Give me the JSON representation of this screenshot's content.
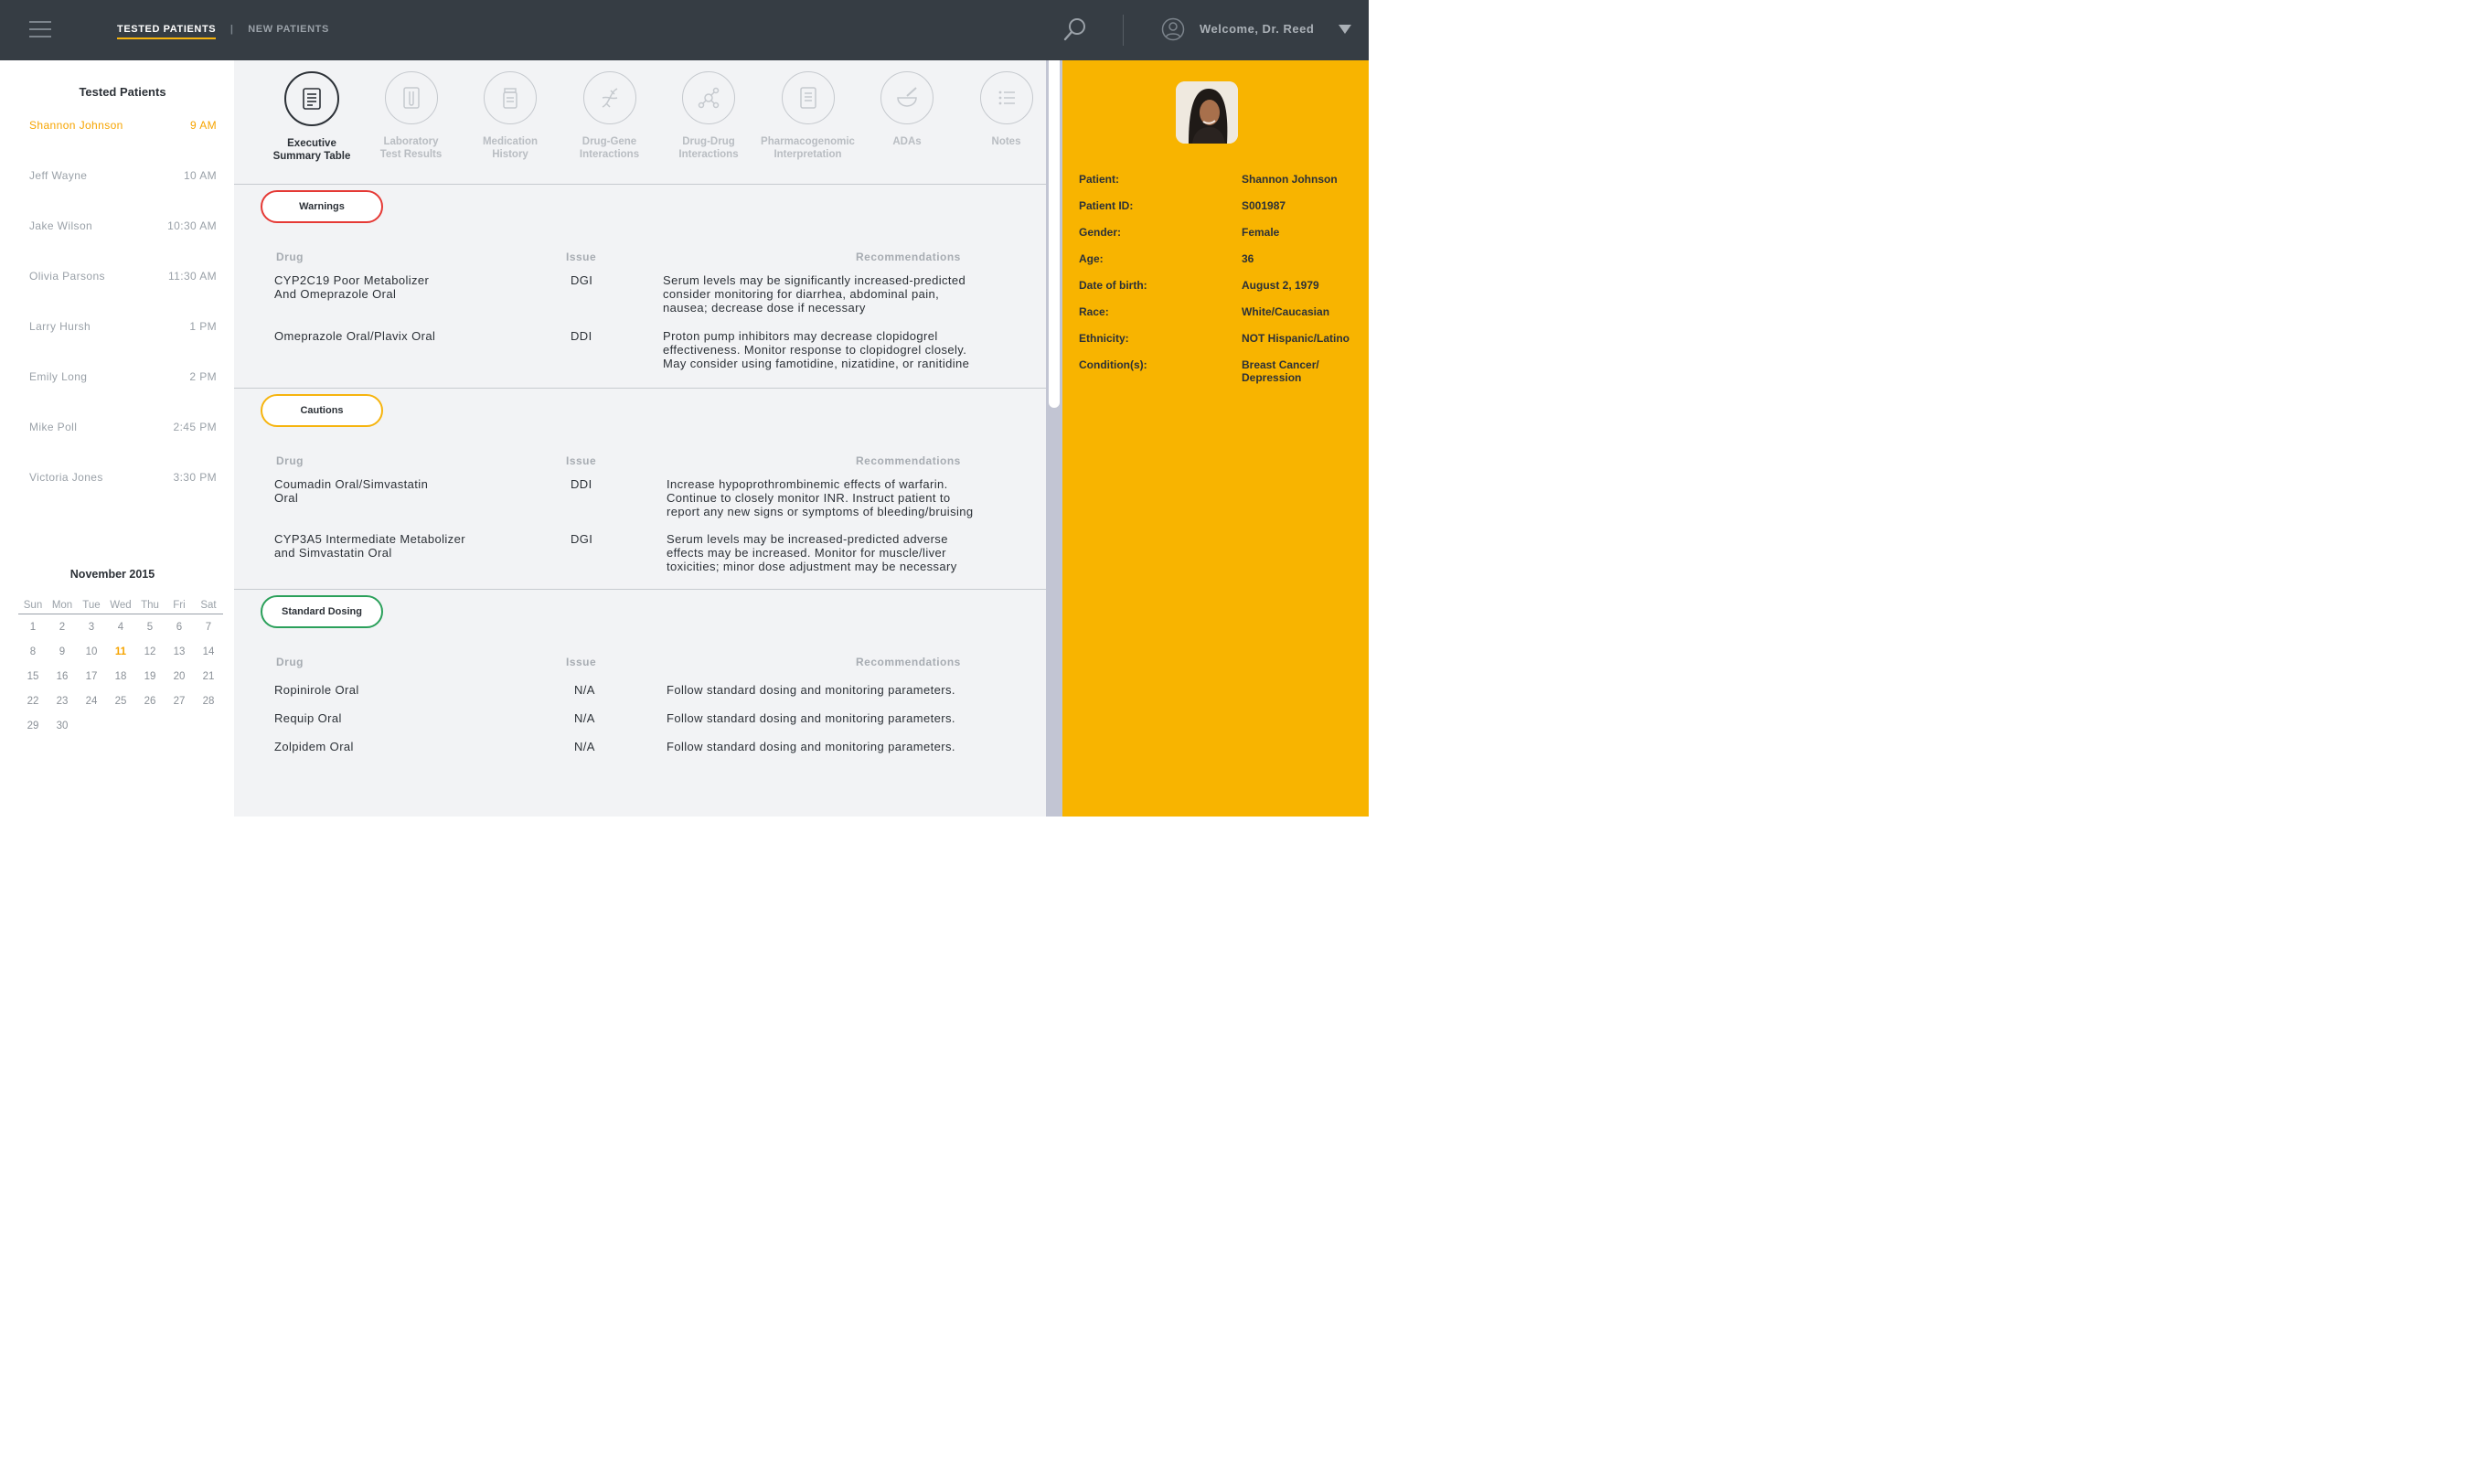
{
  "topbar": {
    "tabs": [
      {
        "label": "TESTED PATIENTS",
        "active": true
      },
      {
        "label": "NEW PATIENTS",
        "active": false
      }
    ],
    "separator": "|",
    "welcome": "Welcome, Dr. Reed"
  },
  "sidebar": {
    "title": "Tested Patients",
    "patients": [
      {
        "name": "Shannon Johnson",
        "time": "9 AM",
        "active": true
      },
      {
        "name": "Jeff Wayne",
        "time": "10 AM"
      },
      {
        "name": "Jake Wilson",
        "time": "10:30 AM"
      },
      {
        "name": "Olivia Parsons",
        "time": "11:30 AM"
      },
      {
        "name": "Larry Hursh",
        "time": "1 PM"
      },
      {
        "name": "Emily Long",
        "time": "2 PM"
      },
      {
        "name": "Mike Poll",
        "time": "2:45 PM"
      },
      {
        "name": "Victoria Jones",
        "time": "3:30 PM"
      }
    ]
  },
  "calendar": {
    "month": "November 2015",
    "days_of_week": [
      "Sun",
      "Mon",
      "Tue",
      "Wed",
      "Thu",
      "Fri",
      "Sat"
    ],
    "weeks": [
      [
        "1",
        "2",
        "3",
        "4",
        "5",
        "6",
        "7"
      ],
      [
        "8",
        "9",
        "10",
        "11",
        "12",
        "13",
        "14"
      ],
      [
        "15",
        "16",
        "17",
        "18",
        "19",
        "20",
        "21"
      ],
      [
        "22",
        "23",
        "24",
        "25",
        "26",
        "27",
        "28"
      ],
      [
        "29",
        "30",
        "",
        "",
        "",
        "",
        ""
      ]
    ],
    "today": "11"
  },
  "tabs": [
    {
      "label": "Executive\nSummary Table",
      "icon": "summary-table-icon",
      "active": true
    },
    {
      "label": "Laboratory\nTest Results",
      "icon": "test-tube-icon"
    },
    {
      "label": "Medication\nHistory",
      "icon": "pill-bottle-icon"
    },
    {
      "label": "Drug-Gene\nInteractions",
      "icon": "dna-icon"
    },
    {
      "label": "Drug-Drug\nInteractions",
      "icon": "molecule-icon"
    },
    {
      "label": "Pharmacogenomic\nInterpretation",
      "icon": "document-icon"
    },
    {
      "label": "ADAs",
      "icon": "mortar-pestle-icon"
    },
    {
      "label": "Notes",
      "icon": "notes-list-icon"
    }
  ],
  "columns": {
    "drug": "Drug",
    "issue": "Issue",
    "recommendations": "Recommendations"
  },
  "sections": [
    {
      "title": "Warnings",
      "color": "#e53935",
      "rows": [
        {
          "drug": "CYP2C19 Poor Metabolizer\nAnd Omeprazole Oral",
          "issue": "DGI",
          "recommendation": "Serum levels may be significantly increased-predicted\nconsider monitoring for diarrhea, abdominal pain,\nnausea; decrease dose if necessary"
        },
        {
          "drug": "Omeprazole Oral/Plavix Oral",
          "issue": "DDI",
          "recommendation": "Proton pump inhibitors may decrease clopidogrel\neffectiveness. Monitor response to clopidogrel closely.\nMay consider using famotidine, nizatidine, or ranitidine"
        }
      ]
    },
    {
      "title": "Cautions",
      "color": "#f6b40e",
      "rows": [
        {
          "drug": "Coumadin Oral/Simvastatin\nOral",
          "issue": "DDI",
          "recommendation": "Increase hypoprothrombinemic effects of warfarin.\nContinue to closely monitor INR. Instruct patient to\nreport any new signs or symptoms of bleeding/bruising"
        },
        {
          "drug": "CYP3A5 Intermediate Metabolizer\nand Simvastatin Oral",
          "issue": "DGI",
          "recommendation": "Serum levels may be increased-predicted adverse\neffects may be increased. Monitor for muscle/liver\ntoxicities; minor dose adjustment may be necessary"
        }
      ]
    },
    {
      "title": "Standard Dosing",
      "color": "#2aa05a",
      "rows": [
        {
          "drug": "Ropinirole Oral",
          "issue": "N/A",
          "recommendation": "Follow standard dosing and monitoring parameters."
        },
        {
          "drug": "Requip Oral",
          "issue": "N/A",
          "recommendation": "Follow standard dosing and monitoring parameters."
        },
        {
          "drug": "Zolpidem Oral",
          "issue": "N/A",
          "recommendation": "Follow standard dosing and monitoring parameters."
        }
      ]
    }
  ],
  "patient_info": [
    {
      "label": "Patient:",
      "value": "Shannon Johnson"
    },
    {
      "label": "Patient ID:",
      "value": "S001987"
    },
    {
      "label": "Gender:",
      "value": "Female"
    },
    {
      "label": "Age:",
      "value": "36"
    },
    {
      "label": "Date of birth:",
      "value": "August 2, 1979"
    },
    {
      "label": "Race:",
      "value": "White/Caucasian"
    },
    {
      "label": "Ethnicity:",
      "value": "NOT Hispanic/Latino"
    },
    {
      "label": "Condition(s):",
      "value": "Breast Cancer/\nDepression"
    }
  ],
  "colors": {
    "accent": "#f6b40e",
    "topbar": "#363d44",
    "panel": "#f8b400"
  }
}
